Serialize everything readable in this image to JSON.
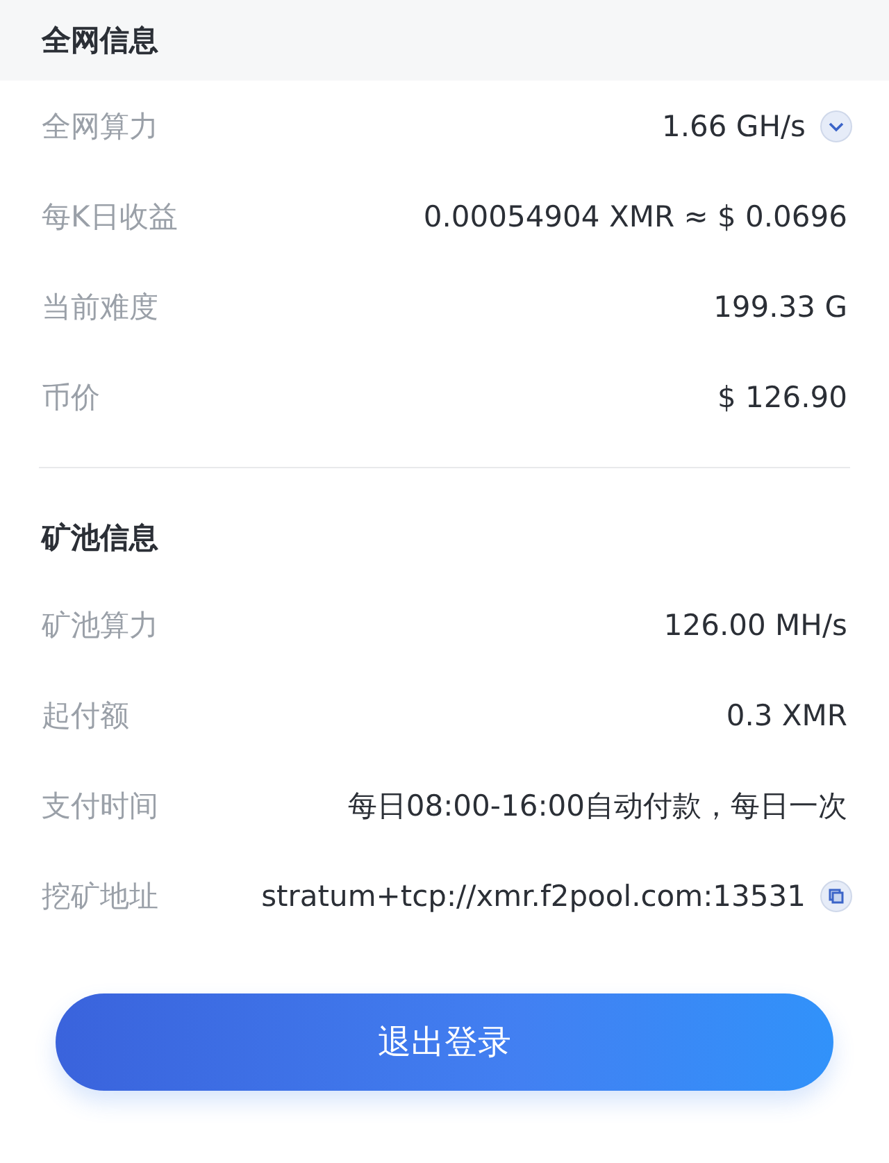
{
  "network_info": {
    "title": "全网信息",
    "rows": [
      {
        "label": "全网算力",
        "value": "1.66 GH/s",
        "kind": "expand"
      },
      {
        "label": "每K日收益",
        "value": "0.00054904 XMR ≈ $ 0.0696",
        "kind": "plain"
      },
      {
        "label": "当前难度",
        "value": "199.33 G",
        "kind": "plain"
      },
      {
        "label": "币价",
        "value": "$ 126.90",
        "kind": "plain"
      }
    ]
  },
  "pool_info": {
    "title": "矿池信息",
    "rows": [
      {
        "label": "矿池算力",
        "value": "126.00 MH/s",
        "kind": "plain"
      },
      {
        "label": "起付额",
        "value": "0.3 XMR",
        "kind": "plain"
      },
      {
        "label": "支付时间",
        "value": "每日08:00-16:00自动付款，每日一次",
        "kind": "plain"
      },
      {
        "label": "挖矿地址",
        "value": "stratum+tcp://xmr.f2pool.com:13531",
        "kind": "copy"
      }
    ]
  },
  "logout_button": "退出登录"
}
